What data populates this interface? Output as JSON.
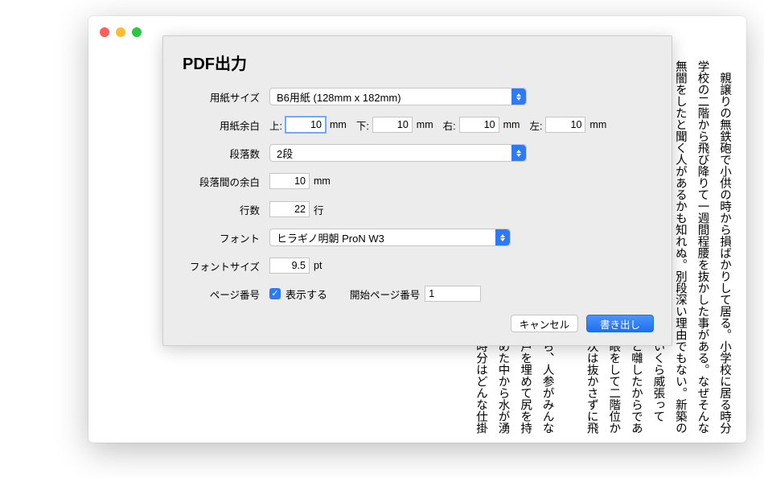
{
  "dialog": {
    "title": "PDF出力",
    "labels": {
      "paper_size": "用紙サイズ",
      "margins": "用紙余白",
      "columns": "段落数",
      "column_gap": "段落間の余白",
      "lines": "行数",
      "font": "フォント",
      "font_size": "フォントサイズ",
      "page_number": "ページ番号"
    },
    "paper_size": "B6用紙 (128mm x 182mm)",
    "margins_sublabels": {
      "top": "上:",
      "bottom": "下:",
      "right": "右:",
      "left": "左:"
    },
    "margins": {
      "top": "10",
      "bottom": "10",
      "right": "10",
      "left": "10"
    },
    "margin_unit": "mm",
    "columns": "2段",
    "column_gap": "10",
    "column_gap_unit": "mm",
    "lines": "22",
    "lines_unit": "行",
    "font": "ヒラギノ明朝 ProN W3",
    "font_size": "9.5",
    "font_size_unit": "pt",
    "show_page_number_label": "表示する",
    "start_page_label": "開始ページ番号",
    "start_page": "1",
    "buttons": {
      "cancel": "キャンセル",
      "export": "書き出し"
    }
  },
  "bg_text": "　親譲りの無鉄砲で小供の時から損ばかりして居る。小学校に居る時分学校の二階から飛び降りて一週間程腰を抜かした事がある。なぜそんな無闇をしたと聞く人があるかも知れぬ。別段深い理由でもない。新築の二階から首を出して居たら、同級生の一人が冗談に、いくら威張っても、そこから飛び降りる事は出来まい。弱虫やーい。と囃したからである。小使に負ぶさって帰って来た時、おやじが大きな眼をして二階位から飛び降りて腰を抜かす奴があるかと云ったから、此次は抜かさずに飛んで見せますと答えた。　　　　　　　　　　　　　　　　　　　　　　　　　　　　　　　　　　　　　　　　　　　　　　　　　　　　　　　　　　　　　　　　　　　　　　　　　　　　　　　　　　　　　　　　　　　　　　　　　　　　　　　　　　　　　　たから、其上で三人が半日相撲をとりつゞけに取つたら、人参がみんな踏みつぶされて仕舞つた。古川の持つて居る田圃の井戸を埋めて尻を持ち込まれた事もある。太い孟宗の節を抜いて、深く埋めた中から水が湧き出て、そこいらの稲に水がかゝる仕掛であつた。其時分はどんな仕掛かしら"
}
